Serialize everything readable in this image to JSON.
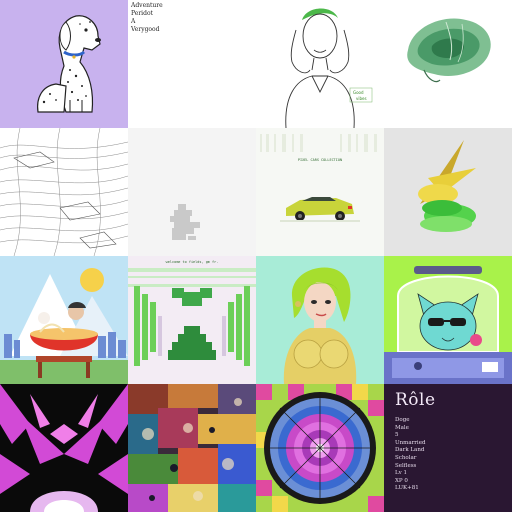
{
  "gallery": {
    "tiles": [
      {
        "label": "dalmatian-art"
      },
      {
        "label": "text-art",
        "lines": [
          "Adventure",
          "Peridot",
          "A",
          "Verygood"
        ]
      },
      {
        "label": "sketch-person-art",
        "scribble": [
          "Good",
          "vibes"
        ]
      },
      {
        "label": "green-blob-art"
      },
      {
        "label": "topographic-art"
      },
      {
        "label": "pixel-blocks-art"
      },
      {
        "label": "pixel-car-art",
        "caption": "PIXEL CARS COLLECTION"
      },
      {
        "label": "geometric-shapes-art"
      },
      {
        "label": "ramen-landscape-art"
      },
      {
        "label": "green-pixel-art",
        "caption": "welcome to fields, gm fr."
      },
      {
        "label": "green-hair-girl-art"
      },
      {
        "label": "cat-in-jar-art"
      },
      {
        "label": "pink-kaleidoscope-art"
      },
      {
        "label": "dense-collage-art"
      },
      {
        "label": "psychedelic-mandala-art"
      },
      {
        "label": "role-card",
        "title": "Rôle",
        "lines": [
          "Doge",
          "Male",
          "5",
          "Unmarried",
          "Dark Land",
          "Scholar",
          "Selfless",
          "Lv 1",
          "XP 0",
          "LUK+81"
        ]
      }
    ]
  },
  "colors": {
    "lavender": "#c8b2ee",
    "role_bg": "#2a1732",
    "mint": "#a8ecd7",
    "lime": "#a9f24a"
  }
}
